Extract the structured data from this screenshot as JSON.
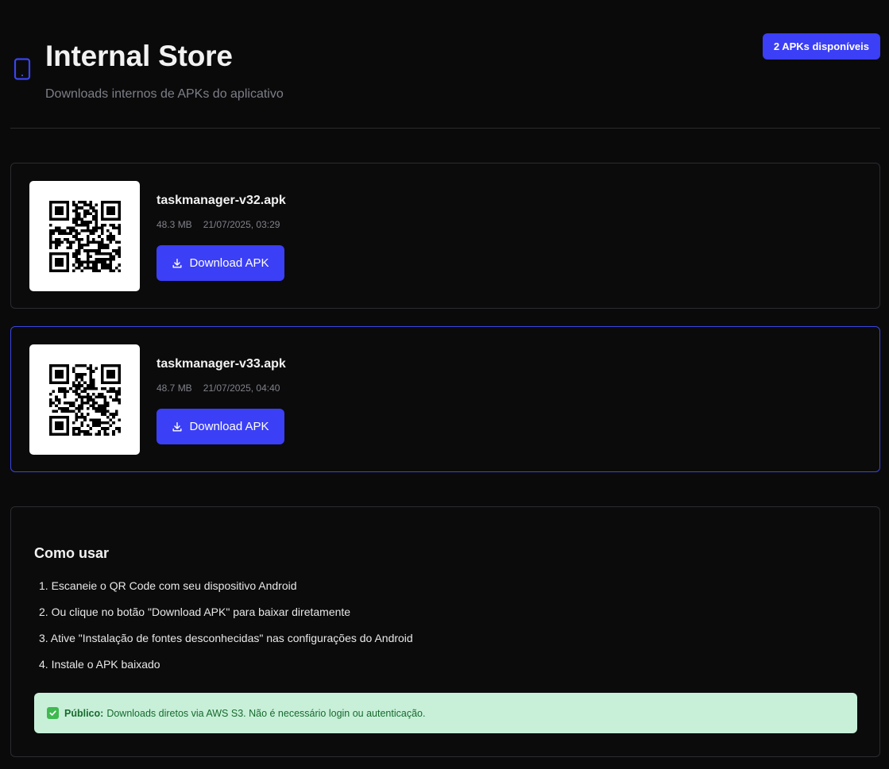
{
  "header": {
    "title": "Internal Store",
    "subtitle": "Downloads internos de APKs do aplicativo",
    "badge": "2 APKs disponíveis",
    "icon": "smartphone-icon"
  },
  "apks": [
    {
      "name": "taskmanager-v32.apk",
      "size": "48.3 MB",
      "date": "21/07/2025, 03:29",
      "button_label": "Download APK",
      "selected": false
    },
    {
      "name": "taskmanager-v33.apk",
      "size": "48.7 MB",
      "date": "21/07/2025, 04:40",
      "button_label": "Download APK",
      "selected": true
    }
  ],
  "help": {
    "title": "Como usar",
    "steps": [
      "1. Escaneie o QR Code com seu dispositivo Android",
      "2. Ou clique no botão \"Download APK\" para baixar diretamente",
      "3. Ative \"Instalação de fontes desconhecidas\" nas configurações do Android",
      "4. Instale o APK baixado"
    ],
    "notice_label": "Público:",
    "notice_text": "Downloads diretos via AWS S3. Não é necessário login ou autenticação."
  },
  "colors": {
    "accent": "#3b3ff5",
    "background": "#0a0a0b",
    "notice_bg": "#c8f0d8",
    "notice_text": "#166a2e"
  }
}
